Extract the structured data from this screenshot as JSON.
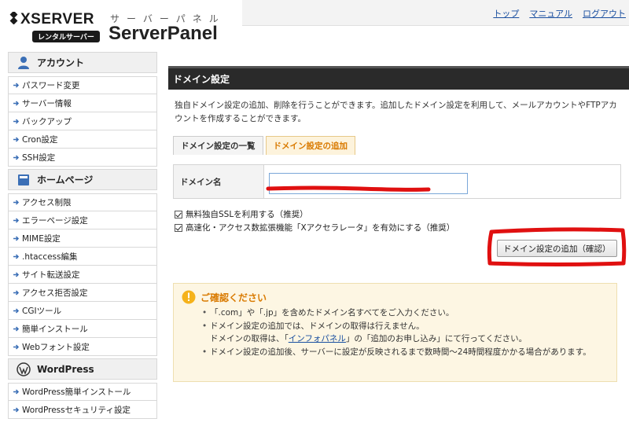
{
  "brand": {
    "logo_text": "XSERVER",
    "badge": "レンタルサーバー",
    "sub_title": "サーバーパネル",
    "title": "ServerPanel"
  },
  "top_links": [
    "トップ",
    "マニュアル",
    "ログアウト"
  ],
  "sidebar": {
    "sections": [
      {
        "title": "アカウント",
        "icon": "user-icon",
        "items": [
          "パスワード変更",
          "サーバー情報",
          "バックアップ",
          "Cron設定",
          "SSH設定"
        ]
      },
      {
        "title": "ホームページ",
        "icon": "book-icon",
        "items": [
          "アクセス制限",
          "エラーページ設定",
          "MIME設定",
          ".htaccess編集",
          "サイト転送設定",
          "アクセス拒否設定",
          "CGIツール",
          "簡単インストール",
          "Webフォント設定"
        ]
      },
      {
        "title": "WordPress",
        "icon": "wordpress-icon",
        "items": [
          "WordPress簡単インストール",
          "WordPressセキュリティ設定"
        ]
      }
    ]
  },
  "main": {
    "page_title": "ドメイン設定",
    "intro": "独自ドメイン設定の追加、削除を行うことができます。追加したドメイン設定を利用して、メールアカウントやFTPアカウントを作成することができます。",
    "tabs": [
      {
        "label": "ドメイン設定の一覧",
        "active": false
      },
      {
        "label": "ドメイン設定の追加",
        "active": true
      }
    ],
    "form": {
      "domain_label": "ドメイン名",
      "domain_value": ""
    },
    "checkboxes": [
      {
        "label": "無料独自SSLを利用する（推奨）",
        "checked": true
      },
      {
        "label": "高速化・アクセス数拡張機能「Xアクセラレータ」を有効にする（推奨）",
        "checked": true
      }
    ],
    "confirm_button": "ドメイン設定の追加（確認）"
  },
  "notice": {
    "title": "ご確認ください",
    "items": [
      {
        "text": "「.com」や「.jp」を含めたドメイン名すべてをご入力ください。"
      },
      {
        "text": "ドメイン設定の追加では、ドメインの取得は行えません。",
        "sub_before": "ドメインの取得は、「",
        "sub_link": "インフォパネル",
        "sub_after": "」の「追加のお申し込み」にて行ってください。"
      },
      {
        "text": "ドメイン設定の追加後、サーバーに設定が反映されるまで数時間〜24時間程度かかる場合があります。"
      }
    ]
  },
  "colors": {
    "accent_orange": "#d97a00",
    "title_bar": "#2a2a2a",
    "link_blue": "#1a4fa0",
    "annotation_red": "#e01010"
  }
}
